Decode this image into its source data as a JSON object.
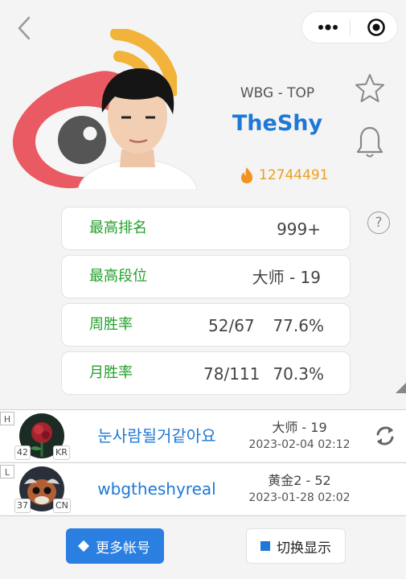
{
  "nav": {
    "back_icon": "chevron-left-icon",
    "more_icon": "more-dots-icon",
    "target_icon": "target-icon"
  },
  "profile": {
    "team_role": "WBG - TOP",
    "name": "TheShy",
    "hot_value": "12744491",
    "hot_icon": "flame-icon",
    "brand_icon": "weibo-logo"
  },
  "actions": {
    "favorite_icon": "star-icon",
    "notify_icon": "bell-icon",
    "help": "?"
  },
  "stats": {
    "highest_rank": {
      "label": "最高排名",
      "value": "999+"
    },
    "highest_tier": {
      "label": "最高段位",
      "value": "大师 - 19"
    },
    "weekly_winrate": {
      "label": "周胜率",
      "record": "52/67",
      "rate": "77.6%"
    },
    "monthly_winrate": {
      "label": "月胜率",
      "record": "78/111",
      "rate": "70.3%"
    }
  },
  "accounts": [
    {
      "tag": "H",
      "level": "42",
      "server": "KR",
      "name": "눈사람될거같아요",
      "rank": "大师 - 19",
      "time": "2023-02-04 02:12"
    },
    {
      "tag": "L",
      "level": "37",
      "server": "CN",
      "name": "wbgtheshyreal",
      "rank": "黄金2 - 52",
      "time": "2023-01-28 02:02"
    }
  ],
  "footer": {
    "more_accounts": "更多帐号",
    "toggle_display": "切换显示"
  },
  "colors": {
    "accent_blue": "#1e78d6",
    "green": "#23a02c",
    "orange": "#e9a01e",
    "button_blue": "#2a7fe0"
  }
}
